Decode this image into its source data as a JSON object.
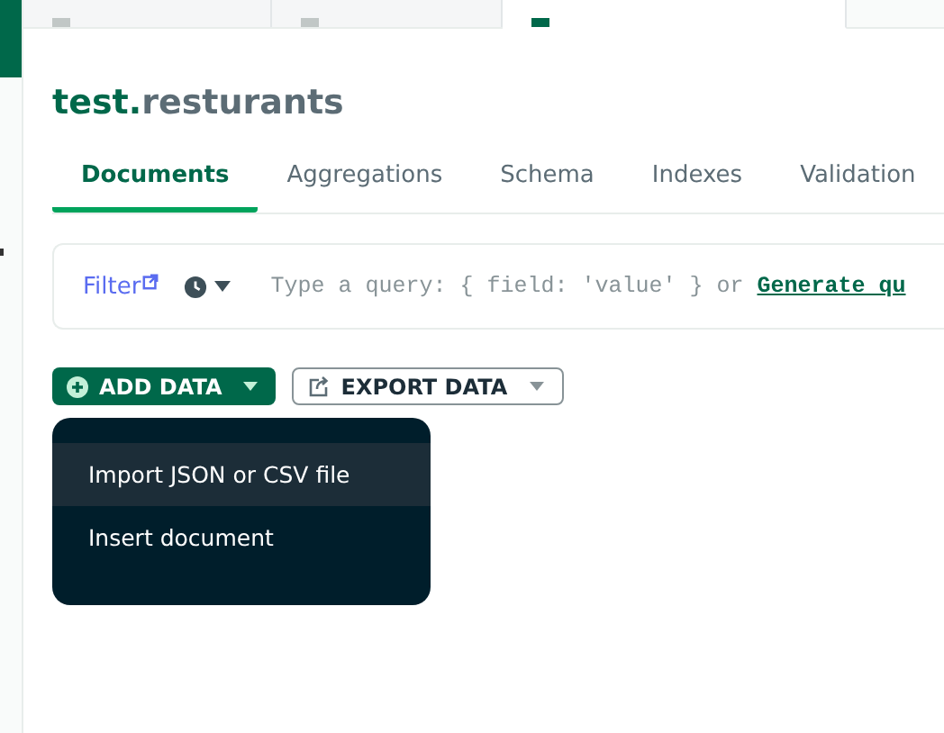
{
  "top_tabs": [
    {
      "kind": "queries",
      "selected": false
    },
    {
      "kind": "database",
      "selected": false
    },
    {
      "kind": "collection",
      "selected": true
    }
  ],
  "title": {
    "database": "test.",
    "collection": "resturants"
  },
  "tabs": [
    {
      "label": "Documents",
      "selected": true
    },
    {
      "label": "Aggregations",
      "selected": false
    },
    {
      "label": "Schema",
      "selected": false
    },
    {
      "label": "Indexes",
      "selected": false
    },
    {
      "label": "Validation",
      "selected": false
    }
  ],
  "filter": {
    "label": "Filter",
    "placeholder": "Type a query: { field: 'value' } or ",
    "link": "Generate qu"
  },
  "add_button": {
    "label": "ADD DATA"
  },
  "export_button": {
    "label": "EXPORT DATA"
  },
  "menu": [
    {
      "label": "Import JSON or CSV file",
      "selected": true
    },
    {
      "label": "Insert document",
      "selected": false
    }
  ]
}
